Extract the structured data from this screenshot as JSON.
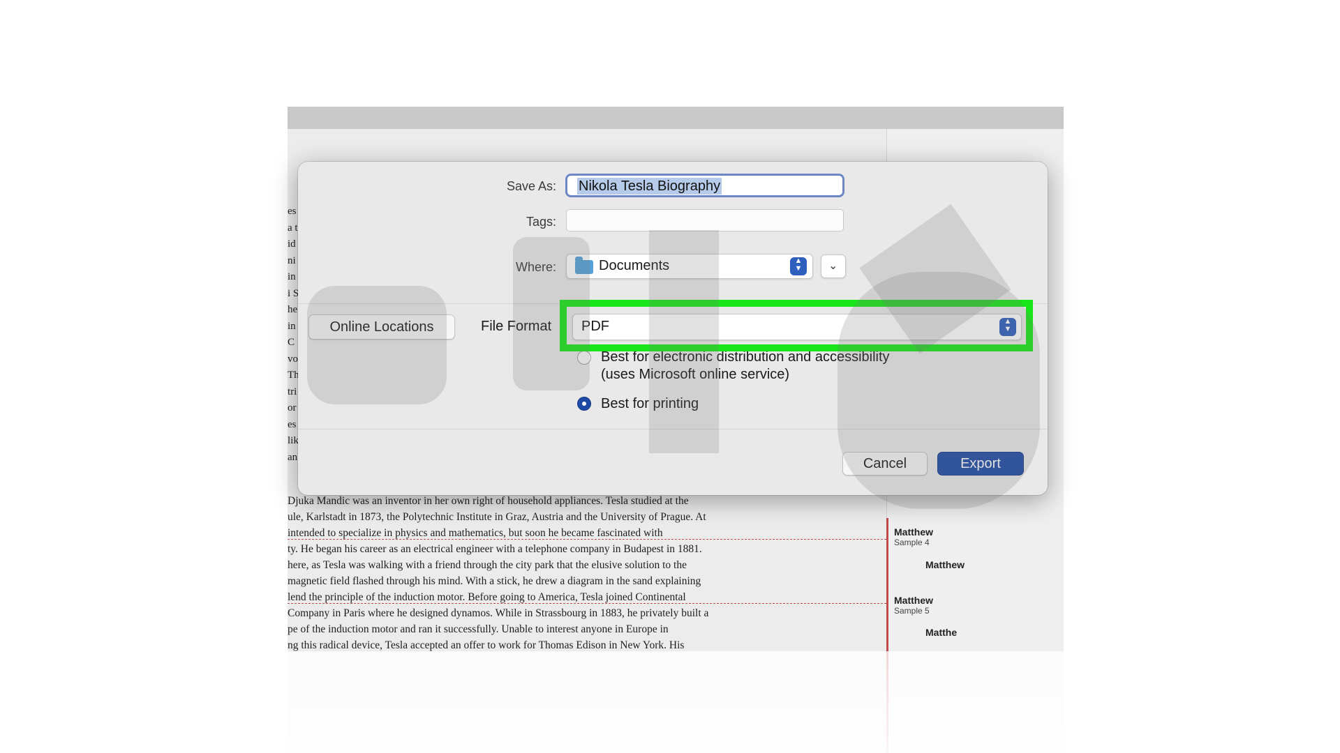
{
  "dialog": {
    "save_as_label": "Save As:",
    "save_as_value": "Nikola Tesla Biography",
    "tags_label": "Tags:",
    "tags_value": "",
    "where_label": "Where:",
    "where_value": "Documents",
    "where_icon": "folder-icon",
    "online_locations_label": "Online Locations",
    "file_format_label": "File Format",
    "file_format_value": "PDF",
    "options": [
      {
        "label_line1": "Best for electronic distribution and accessibility",
        "label_line2": "(uses Microsoft online service)",
        "selected": false
      },
      {
        "label_line1": "Best for printing",
        "selected": true
      }
    ],
    "cancel_label": "Cancel",
    "export_label": "Export",
    "accent_color": "#1f4ba5",
    "highlight_color": "#19e619"
  },
  "document": {
    "lines": [
      "Djuka Mandic was an inventor in her own right of household appliances. Tesla studied at the",
      "ule, Karlstadt in 1873, the Polytechnic Institute in Graz, Austria and the University of Prague. At",
      " intended to specialize in physics and mathematics, but soon he became fascinated with",
      "ty. He began his career as an electrical engineer with a telephone company in Budapest in 1881.",
      "here, as Tesla was walking with a friend through the city park that the elusive solution to the",
      " magnetic field flashed through his mind. With a stick, he drew a diagram in the sand explaining",
      "lend the principle of the induction motor. Before going to America, Tesla joined Continental",
      "Company in Paris where he designed dynamos. While in Strassbourg in 1883, he privately built a",
      "pe of the induction motor and ran it successfully. Unable to interest anyone in Europe in",
      "ng this radical device, Tesla accepted an offer to work for Thomas Edison in New York. His"
    ],
    "left_fragments": [
      "es",
      "a t",
      "id",
      "ni",
      "in",
      "i S",
      "he",
      "in",
      "C",
      "vo",
      "Th",
      "tri",
      "or",
      "es",
      "lik",
      "an"
    ]
  },
  "comments": [
    {
      "name": "Matthew",
      "sub": "Sample 4",
      "reply": "Matthew"
    },
    {
      "name": "Matthew",
      "sub": "Sample 5",
      "reply": "Matthe"
    }
  ]
}
